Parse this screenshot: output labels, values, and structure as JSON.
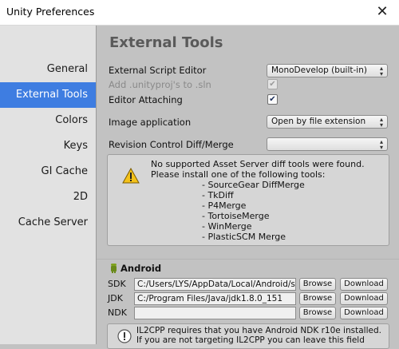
{
  "window": {
    "title": "Unity Preferences",
    "close_glyph": "✕"
  },
  "sidebar": {
    "items": [
      {
        "label": "General",
        "active": false
      },
      {
        "label": "External Tools",
        "active": true
      },
      {
        "label": "Colors",
        "active": false
      },
      {
        "label": "Keys",
        "active": false
      },
      {
        "label": "GI Cache",
        "active": false
      },
      {
        "label": "2D",
        "active": false
      },
      {
        "label": "Cache Server",
        "active": false
      }
    ]
  },
  "main": {
    "title": "External Tools",
    "script_editor": {
      "label": "External Script Editor",
      "value": "MonoDevelop (built-in)"
    },
    "add_unityproj": {
      "label": "Add .unityproj's to .sln",
      "checked": true,
      "enabled": false
    },
    "editor_attaching": {
      "label": "Editor Attaching",
      "checked": true
    },
    "image_app": {
      "label": "Image application",
      "value": "Open by file extension"
    },
    "revision_tool": {
      "label": "Revision Control Diff/Merge",
      "value": ""
    },
    "diff_warning": {
      "line1": "No supported Asset Server diff tools were found.",
      "line2": "Please install one of the following tools:",
      "tools": [
        "- SourceGear DiffMerge",
        "- TkDiff",
        "- P4Merge",
        "- TortoiseMerge",
        "- WinMerge",
        "- PlasticSCM Merge"
      ]
    },
    "android": {
      "heading": "Android",
      "rows": [
        {
          "label": "SDK",
          "path": "C:/Users/LYS/AppData/Local/Android/sdk",
          "browse": "Browse",
          "download": "Download"
        },
        {
          "label": "JDK",
          "path": "C:/Program Files/Java/jdk1.8.0_151",
          "browse": "Browse",
          "download": "Download"
        },
        {
          "label": "NDK",
          "path": "",
          "browse": "Browse",
          "download": "Download"
        }
      ],
      "il2cpp_note": {
        "line1": "IL2CPP requires that you have Android NDK r10e installed.",
        "line2": "If you are not targeting IL2CPP you can leave this field"
      }
    }
  },
  "colors": {
    "accent": "#3e7de1"
  }
}
